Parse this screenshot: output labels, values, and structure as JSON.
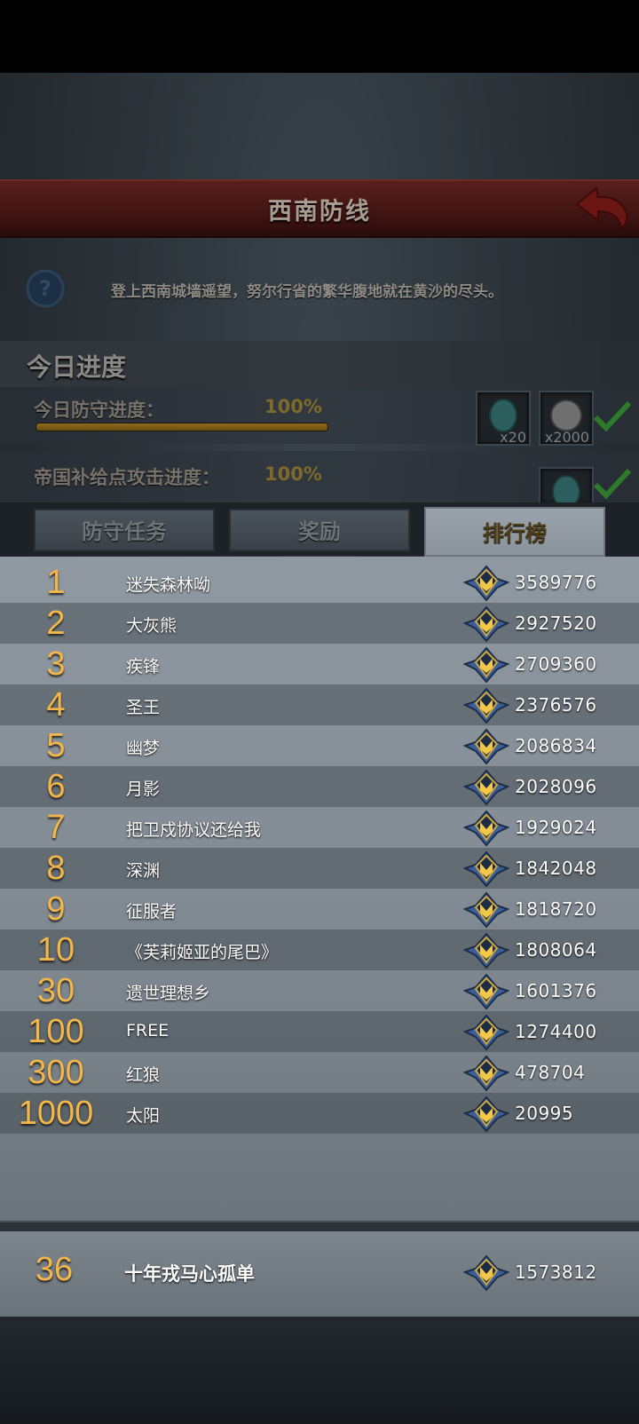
{
  "header": {
    "title": "西南防线"
  },
  "info": {
    "description": "登上西南城墙遥望，努尔行省的繁华腹地就在黄沙的尽头。"
  },
  "progress": {
    "section_title": "今日进度",
    "items": [
      {
        "label": "今日防守进度：",
        "percent_text": "100%",
        "percent": 100,
        "rewards": [
          "x20",
          "x2000"
        ]
      },
      {
        "label": "帝国补给点攻击进度：",
        "percent_text": "100%",
        "percent": 100,
        "rewards": [
          ""
        ]
      }
    ]
  },
  "tabs": [
    {
      "label": "防守任务",
      "active": false
    },
    {
      "label": "奖励",
      "active": false
    },
    {
      "label": "排行榜",
      "active": true
    }
  ],
  "ranking": {
    "rows": [
      {
        "rank": "1",
        "name": "迷失森林呦",
        "score": "3589776"
      },
      {
        "rank": "2",
        "name": "大灰熊",
        "score": "2927520"
      },
      {
        "rank": "3",
        "name": "疾锋",
        "score": "2709360"
      },
      {
        "rank": "4",
        "name": "圣王",
        "score": "2376576"
      },
      {
        "rank": "5",
        "name": "幽梦",
        "score": "2086834"
      },
      {
        "rank": "6",
        "name": "月影",
        "score": "2028096"
      },
      {
        "rank": "7",
        "name": "把卫戍协议还给我",
        "score": "1929024"
      },
      {
        "rank": "8",
        "name": "深渊",
        "score": "1842048"
      },
      {
        "rank": "9",
        "name": "征服者",
        "score": "1818720"
      },
      {
        "rank": "10",
        "name": "《芙莉姬亚的尾巴》",
        "score": "1808064"
      },
      {
        "rank": "30",
        "name": "遗世理想乡",
        "score": "1601376"
      },
      {
        "rank": "100",
        "name": "FREE",
        "score": "1274400"
      },
      {
        "rank": "300",
        "name": "红狼",
        "score": "478704"
      },
      {
        "rank": "1000",
        "name": "太阳",
        "score": "20995"
      }
    ],
    "self": {
      "rank": "36",
      "name": "十年戎马心孤单",
      "score": "1573812"
    }
  },
  "icons": {
    "back": "back-arrow-icon",
    "help": "question-icon",
    "badge": "rank-badge-icon",
    "check": "check-icon"
  },
  "colors": {
    "rank_gold": "#f2b64a",
    "title_red": "#5a1f1d",
    "check_green": "#2c8a2a"
  }
}
